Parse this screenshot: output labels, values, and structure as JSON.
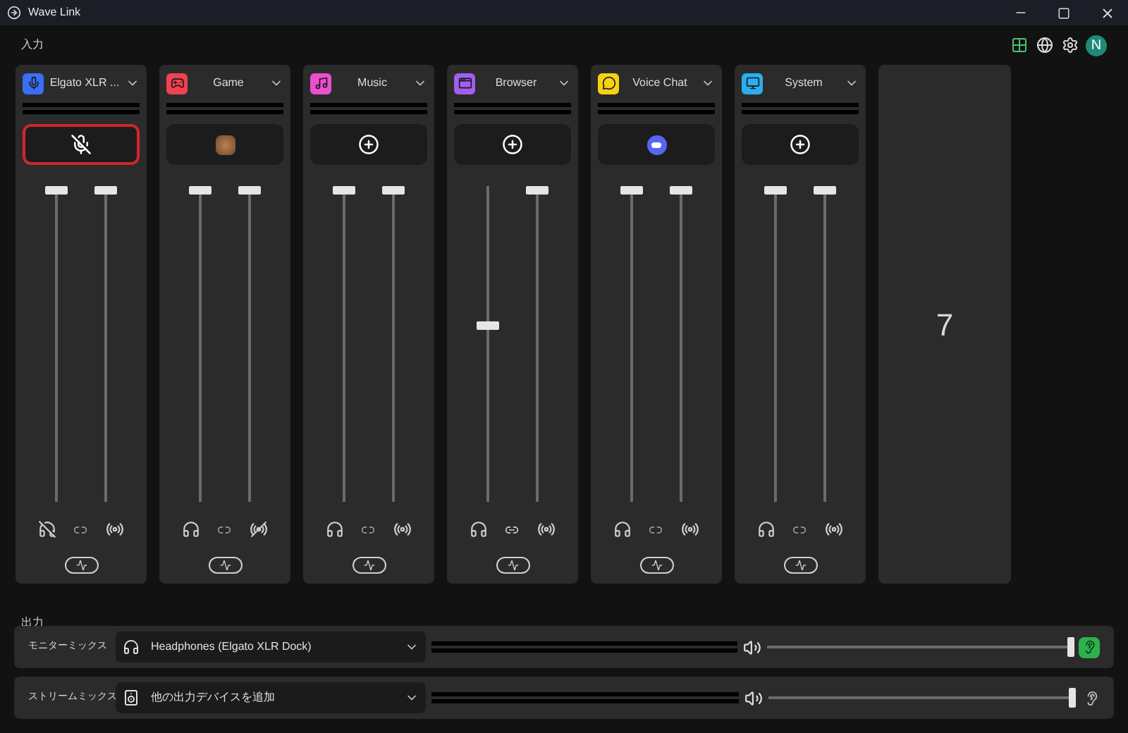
{
  "window": {
    "title": "Wave Link"
  },
  "inputs_label": "入力",
  "profile": {
    "initial": "N"
  },
  "channels": [
    {
      "name": "Elgato XLR ...",
      "color": "#3b6ef5",
      "source": {
        "kind": "mute",
        "active": true
      },
      "monitor": {
        "level": 1,
        "muted": true
      },
      "stream": {
        "level": 1,
        "muted": false
      },
      "linked": false
    },
    {
      "name": "Game",
      "color": "#f0424f",
      "source": {
        "kind": "app",
        "active": false
      },
      "monitor": {
        "level": 1,
        "muted": false
      },
      "stream": {
        "level": 1,
        "muted": true
      },
      "linked": false
    },
    {
      "name": "Music",
      "color": "#ec4fd0",
      "source": {
        "kind": "add",
        "active": false
      },
      "monitor": {
        "level": 1,
        "muted": false
      },
      "stream": {
        "level": 1,
        "muted": false
      },
      "linked": false
    },
    {
      "name": "Browser",
      "color": "#a35ef0",
      "source": {
        "kind": "add",
        "active": false
      },
      "monitor": {
        "level": 0.56,
        "muted": false
      },
      "stream": {
        "level": 1,
        "muted": false
      },
      "linked": true
    },
    {
      "name": "Voice Chat",
      "color": "#f5d312",
      "source": {
        "kind": "discord",
        "active": false
      },
      "monitor": {
        "level": 1,
        "muted": false
      },
      "stream": {
        "level": 1,
        "muted": false
      },
      "linked": false
    },
    {
      "name": "System",
      "color": "#2aaef0",
      "source": {
        "kind": "add",
        "active": false
      },
      "monitor": {
        "level": 1,
        "muted": false
      },
      "stream": {
        "level": 1,
        "muted": false
      },
      "linked": false
    }
  ],
  "empty_slot": {
    "label": "7"
  },
  "outputs_label": "出力",
  "outputs": [
    {
      "kind": "headphones",
      "label": "モニターミックス",
      "device": "Headphones (Elgato XLR Dock)",
      "level": 1,
      "listening": true
    },
    {
      "kind": "speaker",
      "label": "ストリームミックス",
      "device": "他の出力デバイスを追加",
      "level": 1,
      "listening": false
    }
  ]
}
